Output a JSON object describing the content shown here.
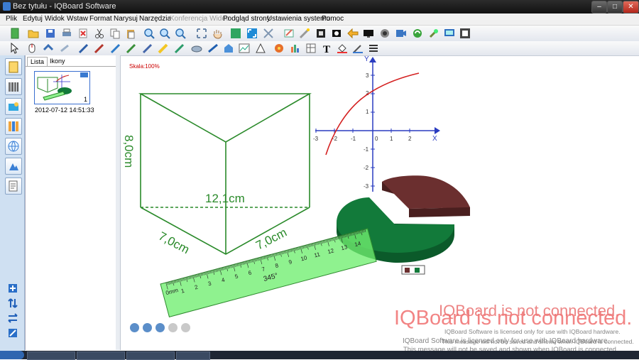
{
  "window": {
    "title": "Bez tytułu - IQBoard Software",
    "controls": {
      "minimize": "–",
      "maximize": "□",
      "close": "✕"
    }
  },
  "menu": [
    {
      "label": "Plik",
      "enabled": true
    },
    {
      "label": "Edytuj",
      "enabled": true
    },
    {
      "label": "Widok",
      "enabled": true
    },
    {
      "label": "Wstaw",
      "enabled": true
    },
    {
      "label": "Format",
      "enabled": true
    },
    {
      "label": "Narysuj",
      "enabled": true
    },
    {
      "label": "Narzędzia",
      "enabled": true
    },
    {
      "label": "Konferencja Wideo",
      "enabled": false
    },
    {
      "label": "Podgląd strony",
      "enabled": true
    },
    {
      "label": "Ustawienia systemu",
      "enabled": true
    },
    {
      "label": "Pomoc",
      "enabled": true
    }
  ],
  "side_panel": {
    "tabs": [
      "Lista",
      "Ikony"
    ],
    "active_tab": "Lista",
    "thumbnail": {
      "page_number": "1",
      "timestamp": "2012-07-12 14:51:33"
    }
  },
  "canvas": {
    "scale_text": "Skala:100%",
    "prism": {
      "height_label": "8,0cm",
      "diagonal_label": "12,1cm",
      "edge_left_label": "7,0cm",
      "edge_right_label": "7,0cm"
    },
    "ruler": {
      "angle_label": "345°",
      "unit_label": "0mm",
      "numbers": [
        "1",
        "2",
        "3",
        "4",
        "5",
        "6",
        "7",
        "8",
        "9",
        "10",
        "11",
        "12",
        "13",
        "14"
      ]
    },
    "graph": {
      "x_axis_label": "X",
      "y_axis_label": "Y",
      "x_ticks": [
        "-3",
        "-2",
        "-1",
        "0",
        "1",
        "2"
      ],
      "y_ticks": [
        "3",
        "2",
        "1",
        "-1",
        "-2",
        "-3"
      ],
      "curve_color": "#d42020",
      "axis_color": "#2a3cc0"
    },
    "pie": {
      "colors": [
        "#6b2f2f",
        "#127a3a"
      ]
    }
  },
  "watermark": {
    "line1": "IQBoard is not connected.",
    "line2": "IQBoard is not connected.",
    "license1": "IQBoard Software is licensed only for use with IQBoard hardware.",
    "license2": "IQBoard Software is licensed only for use with IQBoard hardware.",
    "license3": "This message will not be saved and shown when IQBoard is connected.",
    "license4": "This message will not be saved and shown when IQBoard is connected."
  }
}
